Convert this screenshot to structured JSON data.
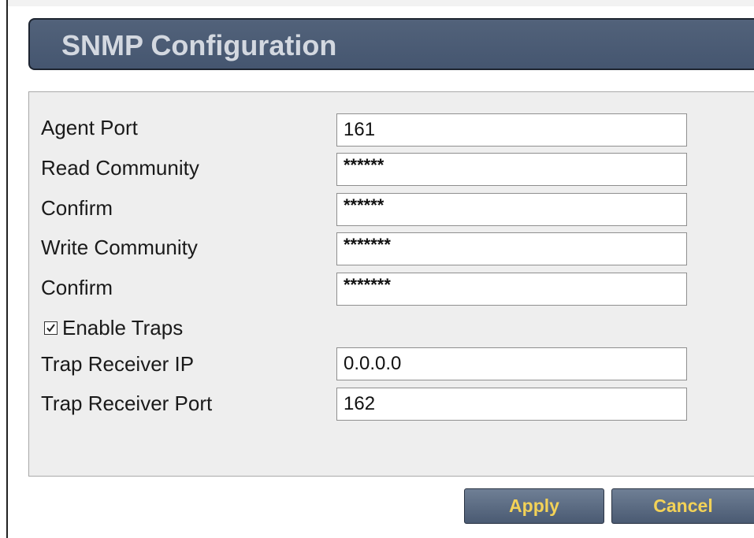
{
  "header": {
    "title": "SNMP Configuration"
  },
  "form": {
    "agent_port": {
      "label": "Agent Port",
      "value": "161"
    },
    "read_community": {
      "label": "Read Community",
      "value": "******"
    },
    "read_confirm": {
      "label": "Confirm",
      "value": "******"
    },
    "write_community": {
      "label": "Write Community",
      "value": "*******"
    },
    "write_confirm": {
      "label": "Confirm",
      "value": "*******"
    },
    "enable_traps": {
      "label": "Enable Traps",
      "checked": true
    },
    "trap_receiver_ip": {
      "label": "Trap Receiver IP",
      "value": "0.0.0.0"
    },
    "trap_receiver_port": {
      "label": "Trap Receiver Port",
      "value": "162"
    }
  },
  "actions": {
    "apply_label": "Apply",
    "cancel_label": "Cancel"
  },
  "colors": {
    "title_bar": "#4b5c75",
    "title_text": "#d3d8e0",
    "panel_background": "#eeeeee",
    "button_background": "#5c6c84",
    "button_text": "#f3d257"
  }
}
